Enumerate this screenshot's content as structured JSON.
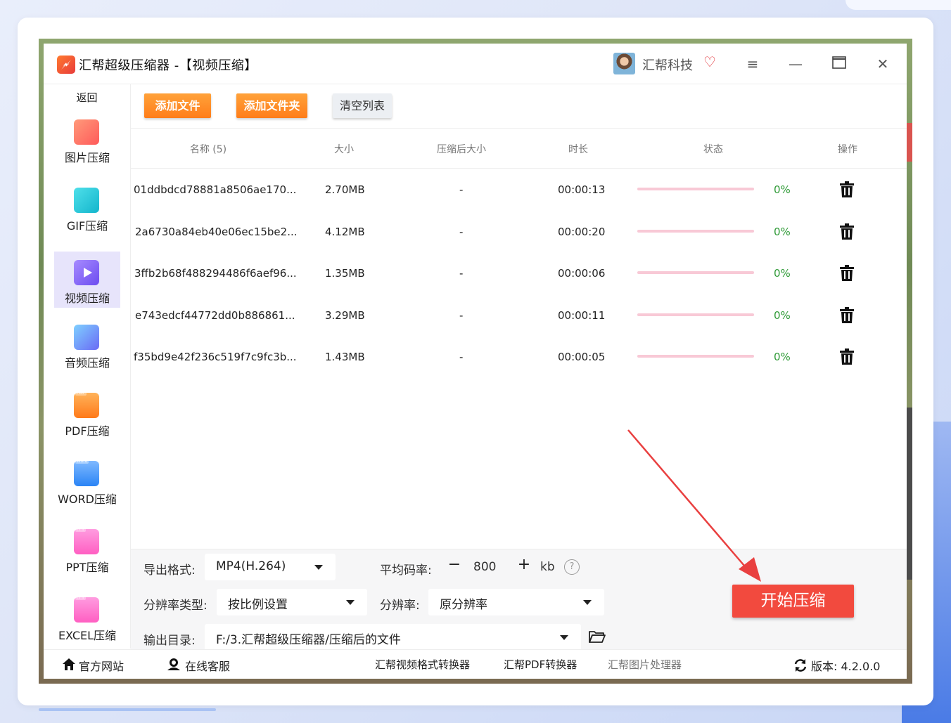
{
  "app": {
    "title": "汇帮超级压缩器   -【视频压缩】",
    "company": "汇帮科技"
  },
  "sidebar": {
    "back": "返回",
    "items": [
      {
        "label": "图片压缩",
        "icon": "image-compress-icon",
        "color": "#ff6d4a"
      },
      {
        "label": "GIF压缩",
        "icon": "gif-compress-icon",
        "color": "#21c6d8"
      },
      {
        "label": "视频压缩",
        "icon": "video-compress-icon",
        "color": "#7b5df5",
        "active": true
      },
      {
        "label": "音频压缩",
        "icon": "audio-compress-icon",
        "color": "#5a87f5"
      },
      {
        "label": "PDF压缩",
        "icon": "pdf-compress-icon",
        "color": "#ff8a2a"
      },
      {
        "label": "WORD压缩",
        "icon": "word-compress-icon",
        "color": "#3a8dff"
      },
      {
        "label": "PPT压缩",
        "icon": "ppt-compress-icon",
        "color": "#ff6fc9"
      },
      {
        "label": "EXCEL压缩",
        "icon": "excel-compress-icon",
        "color": "#ff6fc9"
      }
    ]
  },
  "toolbar": {
    "add_file": "添加文件",
    "add_folder": "添加文件夹",
    "clear_list": "清空列表"
  },
  "table": {
    "headers": [
      "名称 (5)",
      "大小",
      "压缩后大小",
      "时长",
      "状态",
      "操作"
    ],
    "rows": [
      {
        "name": "01ddbdcd78881a8506ae170...",
        "size": "2.70MB",
        "compressed": "-",
        "duration": "00:00:13",
        "progress": "0%"
      },
      {
        "name": "2a6730a84eb40e06ec15be2...",
        "size": "4.12MB",
        "compressed": "-",
        "duration": "00:00:20",
        "progress": "0%"
      },
      {
        "name": "3ffb2b68f488294486f6aef96...",
        "size": "1.35MB",
        "compressed": "-",
        "duration": "00:00:06",
        "progress": "0%"
      },
      {
        "name": "e743edcf44772dd0b886861...",
        "size": "3.29MB",
        "compressed": "-",
        "duration": "00:00:11",
        "progress": "0%"
      },
      {
        "name": "f35bd9e42f236c519f7c9fc3b...",
        "size": "1.43MB",
        "compressed": "-",
        "duration": "00:00:05",
        "progress": "0%"
      }
    ]
  },
  "settings": {
    "export_format_label": "导出格式:",
    "export_format_value": "MP4(H.264)",
    "bitrate_label": "平均码率:",
    "bitrate_value": "800",
    "bitrate_unit": "kb",
    "resolution_type_label": "分辨率类型:",
    "resolution_type_value": "按比例设置",
    "resolution_label": "分辨率:",
    "resolution_value": "原分辨率",
    "output_dir_label": "输出目录:",
    "output_dir_value": "F:/3.汇帮超级压缩器/压缩后的文件",
    "start_button": "开始压缩"
  },
  "footer": {
    "official_site": "官方网站",
    "online_service": "在线客服",
    "video_converter": "汇帮视频格式转换器",
    "pdf_converter": "汇帮PDF转换器",
    "image_processor": "汇帮图片处理器",
    "version": "版本:  4.2.0.0"
  },
  "colors": {
    "accent_orange": "#ff8c24",
    "start_red": "#f24a3e",
    "progress_pink": "#f8c9d6",
    "progress_text_green": "#2e9a36",
    "active_nav": "#e7e4fb"
  }
}
